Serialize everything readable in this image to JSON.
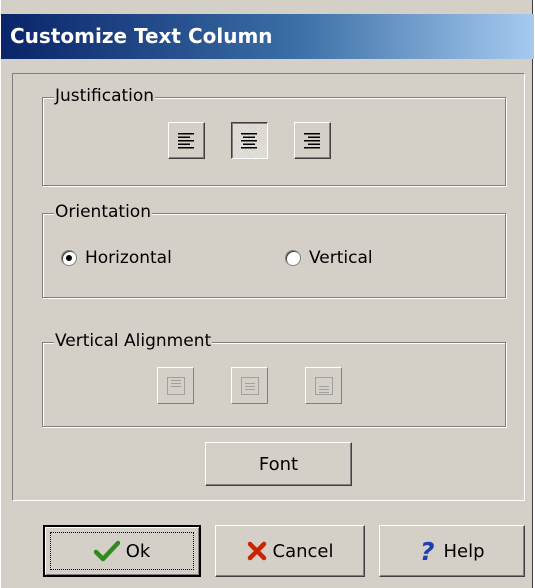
{
  "window": {
    "title": "Customize Text Column"
  },
  "justification": {
    "label": "Justification",
    "buttons": [
      {
        "icon": "align-left-icon",
        "state": "normal"
      },
      {
        "icon": "align-center-icon",
        "state": "pressed"
      },
      {
        "icon": "align-right-icon",
        "state": "normal"
      }
    ]
  },
  "orientation": {
    "label": "Orientation",
    "options": [
      {
        "label": "Horizontal",
        "selected": true
      },
      {
        "label": "Vertical",
        "selected": false
      }
    ]
  },
  "vertical_alignment": {
    "label": "Vertical Alignment",
    "buttons": [
      {
        "icon": "valign-top-icon",
        "state": "disabled"
      },
      {
        "icon": "valign-middle-icon",
        "state": "disabled"
      },
      {
        "icon": "valign-bottom-icon",
        "state": "disabled"
      }
    ]
  },
  "font_button": {
    "label": "Font"
  },
  "footer": {
    "ok_label": "Ok",
    "cancel_label": "Cancel",
    "help_label": "Help"
  },
  "colors": {
    "title_start": "#0a246a",
    "title_end": "#a6caf0",
    "face": "#d4d0c8",
    "ok_check": "#2e8b1e",
    "cancel_x": "#cc2200",
    "help_q": "#1f3fb5"
  }
}
